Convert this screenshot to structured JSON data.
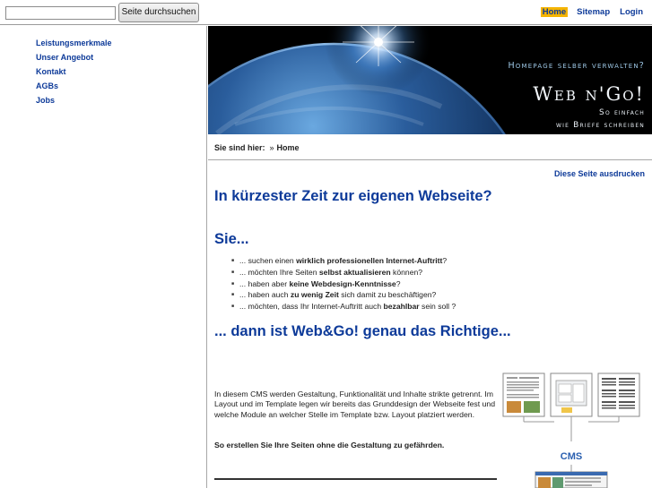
{
  "search": {
    "value": "",
    "placeholder": "",
    "button_label": "Seite durchsuchen"
  },
  "topnav": [
    {
      "label": "Home",
      "active": true
    },
    {
      "label": "Sitemap",
      "active": false
    },
    {
      "label": "Login",
      "active": false
    }
  ],
  "sidebar": {
    "items": [
      {
        "label": "Leistungsmerkmale"
      },
      {
        "label": "Unser Angebot"
      },
      {
        "label": "Kontakt"
      },
      {
        "label": "AGBs"
      },
      {
        "label": "Jobs"
      }
    ]
  },
  "banner": {
    "tagline": "Homepage selber verwalten?",
    "brand": "Web n'Go!",
    "line1": "So einfach",
    "line2": "wie Briefe schreiben"
  },
  "breadcrumb": {
    "prefix": "Sie sind hier:",
    "separator": "»",
    "current": "Home"
  },
  "print_link": "Diese Seite ausdrucken",
  "content": {
    "headline": "In kürzester Zeit zur eigenen Webseite?",
    "sie": "Sie...",
    "bullets": [
      {
        "pre": "... suchen einen ",
        "bold": "wirklich professionellen Internet-Auftritt",
        "post": "?"
      },
      {
        "pre": "... möchten Ihre Seiten ",
        "bold": "selbst aktualisieren",
        "post": " können?"
      },
      {
        "pre": "... haben aber ",
        "bold": "keine Webdesign-Kenntnisse",
        "post": "?"
      },
      {
        "pre": "... haben auch ",
        "bold": "zu wenig Zeit",
        "post": " sich damit zu beschäftigen?"
      },
      {
        "pre": "... möchten, dass Ihr Internet-Auftritt auch ",
        "bold": "bezahlbar",
        "post": " sein soll ?"
      }
    ],
    "conclusion": "... dann ist Web&Go! genau das Richtige...",
    "paragraph": "In diesem CMS werden Gestaltung, Funktionalität und Inhalte strikte getrennt. Im Layout und im Template legen wir bereits das Grunddesign der Webseite fest und welche Module an welcher Stelle im Template bzw. Layout platziert werden.",
    "paragraph_bold": "So erstellen Sie Ihre Seiten ohne die Gestaltung zu gefährden.",
    "figure_label": "CMS"
  },
  "colors": {
    "link": "#0d3a99",
    "active_nav_bg": "#f5b400",
    "banner_bg": "#000000",
    "cms_label": "#2a5fb0"
  }
}
